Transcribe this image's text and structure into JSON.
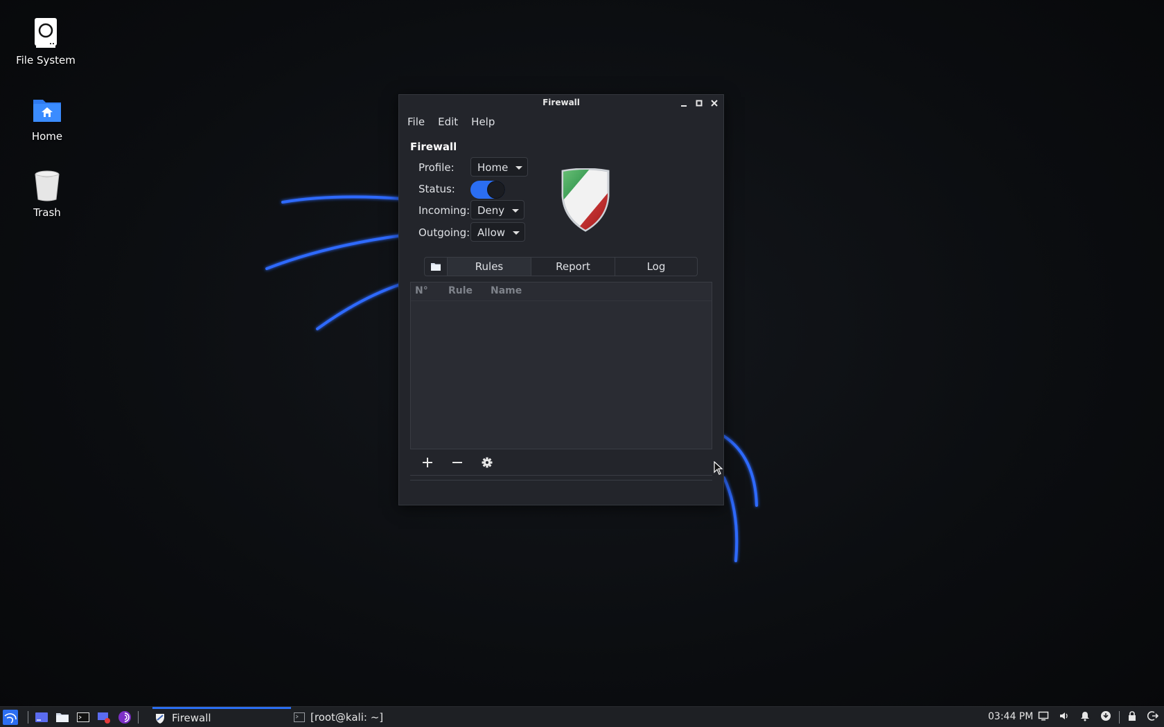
{
  "desktop": {
    "icons": [
      {
        "label": "File System",
        "icon": "drive-icon"
      },
      {
        "label": "Home",
        "icon": "home-folder-icon"
      },
      {
        "label": "Trash",
        "icon": "trash-icon"
      }
    ]
  },
  "window": {
    "title": "Firewall",
    "menu": [
      "File",
      "Edit",
      "Help"
    ],
    "section_title": "Firewall",
    "profile_label": "Profile:",
    "profile_value": "Home",
    "status_label": "Status:",
    "status_on": true,
    "incoming_label": "Incoming:",
    "incoming_value": "Deny",
    "outgoing_label": "Outgoing:",
    "outgoing_value": "Allow",
    "tabs": [
      "Rules",
      "Report",
      "Log"
    ],
    "table_headers": [
      "N°",
      "Rule",
      "Name"
    ],
    "rows": []
  },
  "taskbar": {
    "tasks": [
      {
        "label": "Firewall",
        "active": true
      },
      {
        "label": "[root@kali: ~]",
        "active": false
      }
    ],
    "clock": "03:44 PM"
  },
  "colors": {
    "accent": "#2b6ef2",
    "window_bg": "#23252b",
    "taskbar_bg": "#1e2024"
  }
}
